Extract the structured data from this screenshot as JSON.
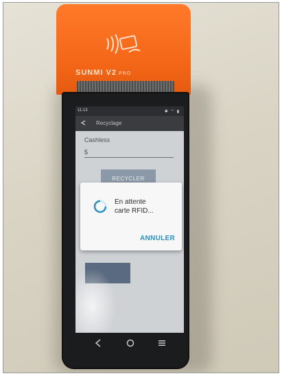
{
  "device": {
    "brand": "SUNMI V2",
    "model_suffix": "PRO",
    "top_color": "#f26516"
  },
  "status_bar": {
    "time": "11:13",
    "icons": "✱ ⌔ ▮"
  },
  "app_bar": {
    "title": "Recyclage",
    "back_icon": "back-arrow-icon"
  },
  "form": {
    "field_label": "Cashless",
    "field_value": "5",
    "recycle_button_label": "RECYCLER"
  },
  "dialog": {
    "line1": "En attente",
    "line2": "carte RFID...",
    "cancel_label": "ANNULER",
    "accent_color": "#2a8fbf"
  },
  "nav_bar": {
    "back_icon": "nav-back-icon",
    "home_icon": "nav-home-icon",
    "menu_icon": "nav-menu-icon"
  }
}
